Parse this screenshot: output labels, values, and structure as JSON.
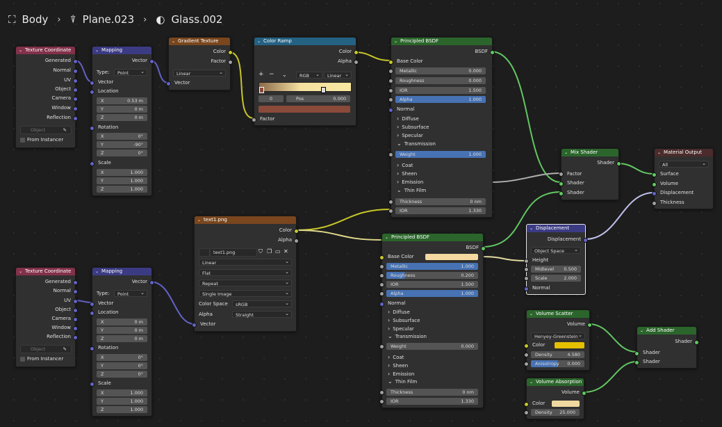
{
  "breadcrumb": {
    "object": "Body",
    "mesh": "Plane.023",
    "material": "Glass.002"
  },
  "colors": {
    "input": "#83314a",
    "vector": "#3b3b84",
    "texture": "#79461d",
    "converter": "#246283",
    "shader": "#2b652b",
    "output": "#4b2b2b"
  },
  "texcoord1": {
    "title": "Texture Coordinate",
    "outputs": [
      "Generated",
      "Normal",
      "UV",
      "Object",
      "Camera",
      "Window",
      "Reflection"
    ],
    "object_placeholder": "Object",
    "instancer": "From Instancer"
  },
  "mapping1": {
    "title": "Mapping",
    "out": "Vector",
    "type_label": "Type:",
    "type": "Point",
    "vector": "Vector",
    "location": "Location",
    "loc": [
      "0.53 m",
      "0 m",
      "0 m"
    ],
    "rotation": "Rotation",
    "rot": [
      "0°",
      "-90°",
      "0°"
    ],
    "scale": "Scale",
    "scl": [
      "1.000",
      "1.000",
      "1.000"
    ],
    "axes": [
      "X",
      "Y",
      "Z"
    ]
  },
  "gradient": {
    "title": "Gradient Texture",
    "out_color": "Color",
    "out_factor": "Factor",
    "type": "Linear",
    "in_vector": "Vector"
  },
  "colorramp": {
    "title": "Color Ramp",
    "out_color": "Color",
    "out_alpha": "Alpha",
    "mode": "RGB",
    "interp": "Linear",
    "index": "0",
    "pos_label": "Pos",
    "pos": "0.000",
    "in_factor": "Factor"
  },
  "bsdf1": {
    "title": "Principled BSDF",
    "out": "BSDF",
    "base_color": "Base Color",
    "metallic": "Metallic",
    "metallic_v": "0.000",
    "roughness": "Roughness",
    "roughness_v": "0.000",
    "ior": "IOR",
    "ior_v": "1.500",
    "alpha": "Alpha",
    "alpha_v": "1.000",
    "normal": "Normal",
    "diffuse": "Diffuse",
    "subsurface": "Subsurface",
    "specular": "Specular",
    "transmission": "Transmission",
    "weight": "Weight",
    "weight_v": "1.000",
    "coat": "Coat",
    "sheen": "Sheen",
    "emission": "Emission",
    "thinfilm": "Thin Film",
    "thickness": "Thickness",
    "thickness_v": "0 nm",
    "ior2": "IOR",
    "ior2_v": "1.330"
  },
  "mix": {
    "title": "Mix Shader",
    "out": "Shader",
    "factor": "Factor",
    "shader1": "Shader",
    "shader2": "Shader"
  },
  "output": {
    "title": "Material Output",
    "target": "All",
    "surface": "Surface",
    "volume": "Volume",
    "displacement": "Displacement",
    "thickness": "Thickness"
  },
  "image": {
    "title": "text1.png",
    "out_color": "Color",
    "out_alpha": "Alpha",
    "filename": "text1.png",
    "interp": "Linear",
    "proj": "Flat",
    "ext": "Repeat",
    "source": "Single Image",
    "cs_label": "Color Space",
    "cs": "sRGB",
    "alpha_label": "Alpha",
    "alpha": "Straight",
    "in_vector": "Vector"
  },
  "texcoord2": {
    "title": "Texture Coordinate",
    "outputs": [
      "Generated",
      "Normal",
      "UV",
      "Object",
      "Camera",
      "Window",
      "Reflection"
    ],
    "object_placeholder": "Object",
    "instancer": "From Instancer"
  },
  "mapping2": {
    "title": "Mapping",
    "out": "Vector",
    "type_label": "Type:",
    "type": "Point",
    "vector": "Vector",
    "location": "Location",
    "loc": [
      "0 m",
      "0 m",
      "0 m"
    ],
    "rotation": "Rotation",
    "rot": [
      "0°",
      "0°",
      "0°"
    ],
    "scale": "Scale",
    "scl": [
      "1.000",
      "1.000",
      "1.000"
    ],
    "axes": [
      "X",
      "Y",
      "Z"
    ]
  },
  "bsdf2": {
    "title": "Principled BSDF",
    "out": "BSDF",
    "base_color": "Base Color",
    "base_color_hex": "#f5d9a0",
    "metallic": "Metallic",
    "metallic_v": "1.000",
    "roughness": "Roughness",
    "roughness_v": "0.200",
    "ior": "IOR",
    "ior_v": "1.500",
    "alpha": "Alpha",
    "alpha_v": "1.000",
    "normal": "Normal",
    "diffuse": "Diffuse",
    "subsurface": "Subsurface",
    "specular": "Specular",
    "transmission": "Transmission",
    "weight": "Weight",
    "weight_v": "0.000",
    "coat": "Coat",
    "sheen": "Sheen",
    "emission": "Emission",
    "thinfilm": "Thin Film",
    "thickness": "Thickness",
    "thickness_v": "0 nm",
    "ior2": "IOR",
    "ior2_v": "1.330"
  },
  "displacement": {
    "title": "Displacement",
    "out": "Displacement",
    "space": "Object Space",
    "height": "Height",
    "midlevel": "Midlevel",
    "midlevel_v": "0.500",
    "scale": "Scale",
    "scale_v": "2.000",
    "normal": "Normal"
  },
  "vscatter": {
    "title": "Volume Scatter",
    "out": "Volume",
    "phase": "Henyey-Greenstein",
    "color": "Color",
    "color_hex": "#e5c000",
    "density": "Density",
    "density_v": "4.580",
    "aniso": "Anisotropy",
    "aniso_v": "0.000"
  },
  "vabsorb": {
    "title": "Volume Absorption",
    "out": "Volume",
    "color": "Color",
    "color_hex": "#f0d9a0",
    "density": "Density",
    "density_v": "25.000"
  },
  "addshader": {
    "title": "Add Shader",
    "out": "Shader",
    "in1": "Shader",
    "in2": "Shader"
  }
}
